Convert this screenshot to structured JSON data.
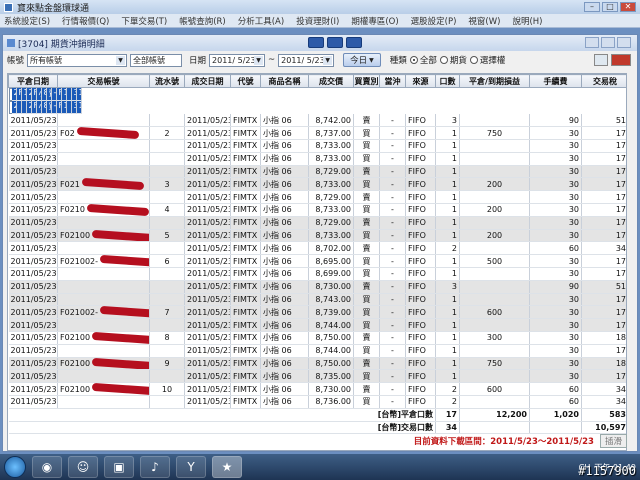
{
  "window": {
    "title": "寶來點金盤環球通"
  },
  "menu": [
    "系統設定(S)",
    "行情報價(Q)",
    "下單交易(T)",
    "帳號查詢(R)",
    "分析工具(A)",
    "投資理財(I)",
    "期權專區(O)",
    "選股設定(P)",
    "視窗(W)",
    "說明(H)"
  ],
  "child": {
    "title": "[3704] 期貨沖銷明細",
    "mid_icons": [
      "grid-icon",
      "chart-icon",
      "close-panel-icon"
    ]
  },
  "toolbar": {
    "account_label": "帳號",
    "account_value": "所有帳號",
    "all_accounts": "全部帳號",
    "date_label": "日期",
    "date_from": "2011/ 5/23",
    "tilde": "~",
    "date_to": "2011/ 5/23",
    "today_button": "今日",
    "type_label": "種類",
    "opt_all": "全部",
    "opt_future": "期貨",
    "opt_option": "選擇權"
  },
  "columns": [
    "平倉日期",
    "交易帳號",
    "流水號",
    "成交日期",
    "代號",
    "商品名稱",
    "成交價",
    "買賣別",
    "當沖",
    "來源",
    "口數",
    "平倉/到期損益",
    "手續費",
    "交易稅"
  ],
  "rows": [
    {
      "group": 1,
      "sel": true,
      "date": "2011/05/23",
      "acct": "F0",
      "serial": "1",
      "tdate": "2011/05/20",
      "code": "FIMTX",
      "name": "小指 06",
      "price": "8,809.00",
      "bs": "賣",
      "dt": "-",
      "src": "FIFO",
      "qty": "1",
      "pnl": "",
      "fee": "30",
      "tax": "18"
    },
    {
      "group": 1,
      "sel": true,
      "date": "2011/05/23",
      "acct": "",
      "serial": "",
      "tdate": "2011/05/20",
      "code": "FIMTX",
      "name": "小指 06",
      "price": "8,821.00",
      "bs": "買",
      "dt": "-",
      "src": "FIFO",
      "qty": "1",
      "pnl": "",
      "fee": "30",
      "tax": "18"
    },
    {
      "group": 2,
      "date": "2011/05/23",
      "acct": "",
      "serial": "",
      "tdate": "2011/05/23",
      "code": "FIMTX",
      "name": "小指 06",
      "price": "8,742.00",
      "bs": "賣",
      "dt": "-",
      "src": "FIFO",
      "qty": "3",
      "pnl": "",
      "fee": "90",
      "tax": "51"
    },
    {
      "group": 2,
      "date": "2011/05/23",
      "acct": "F02",
      "serial": "2",
      "tdate": "2011/05/23",
      "code": "FIMTX",
      "name": "小指 06",
      "price": "8,737.00",
      "bs": "買",
      "dt": "-",
      "src": "FIFO",
      "qty": "1",
      "pnl": "750",
      "fee": "30",
      "tax": "17"
    },
    {
      "group": 2,
      "date": "2011/05/23",
      "acct": "",
      "serial": "",
      "tdate": "2011/05/23",
      "code": "FIMTX",
      "name": "小指 06",
      "price": "8,733.00",
      "bs": "買",
      "dt": "-",
      "src": "FIFO",
      "qty": "1",
      "pnl": "",
      "fee": "30",
      "tax": "17"
    },
    {
      "group": 2,
      "date": "2011/05/23",
      "acct": "",
      "serial": "",
      "tdate": "2011/05/23",
      "code": "FIMTX",
      "name": "小指 06",
      "price": "8,733.00",
      "bs": "買",
      "dt": "-",
      "src": "FIFO",
      "qty": "1",
      "pnl": "",
      "fee": "30",
      "tax": "17"
    },
    {
      "group": 3,
      "date": "2011/05/23",
      "acct": "",
      "serial": "",
      "tdate": "2011/05/23",
      "code": "FIMTX",
      "name": "小指 06",
      "price": "8,729.00",
      "bs": "賣",
      "dt": "-",
      "src": "FIFO",
      "qty": "1",
      "pnl": "",
      "fee": "30",
      "tax": "17"
    },
    {
      "group": 3,
      "date": "2011/05/23",
      "acct": "F021",
      "serial": "3",
      "tdate": "2011/05/23",
      "code": "FIMTX",
      "name": "小指 06",
      "price": "8,733.00",
      "bs": "買",
      "dt": "-",
      "src": "FIFO",
      "qty": "1",
      "pnl": "200",
      "fee": "30",
      "tax": "17"
    },
    {
      "group": 4,
      "date": "2011/05/23",
      "acct": "",
      "serial": "",
      "tdate": "2011/05/23",
      "code": "FIMTX",
      "name": "小指 06",
      "price": "8,729.00",
      "bs": "賣",
      "dt": "-",
      "src": "FIFO",
      "qty": "1",
      "pnl": "",
      "fee": "30",
      "tax": "17"
    },
    {
      "group": 4,
      "date": "2011/05/23",
      "acct": "F0210",
      "serial": "4",
      "tdate": "2011/05/23",
      "code": "FIMTX",
      "name": "小指 06",
      "price": "8,733.00",
      "bs": "買",
      "dt": "-",
      "src": "FIFO",
      "qty": "1",
      "pnl": "200",
      "fee": "30",
      "tax": "17"
    },
    {
      "group": 5,
      "date": "2011/05/23",
      "acct": "",
      "serial": "",
      "tdate": "2011/05/23",
      "code": "FIMTX",
      "name": "小指 06",
      "price": "8,729.00",
      "bs": "賣",
      "dt": "-",
      "src": "FIFO",
      "qty": "1",
      "pnl": "",
      "fee": "30",
      "tax": "17"
    },
    {
      "group": 5,
      "date": "2011/05/23",
      "acct": "F02100",
      "serial": "5",
      "tdate": "2011/05/23",
      "code": "FIMTX",
      "name": "小指 06",
      "price": "8,733.00",
      "bs": "買",
      "dt": "-",
      "src": "FIFO",
      "qty": "1",
      "pnl": "200",
      "fee": "30",
      "tax": "17"
    },
    {
      "group": 6,
      "date": "2011/05/23",
      "acct": "",
      "serial": "",
      "tdate": "2011/05/23",
      "code": "FIMTX",
      "name": "小指 06",
      "price": "8,702.00",
      "bs": "賣",
      "dt": "-",
      "src": "FIFO",
      "qty": "2",
      "pnl": "",
      "fee": "60",
      "tax": "34"
    },
    {
      "group": 6,
      "date": "2011/05/23",
      "acct": "F021002-",
      "serial": "6",
      "tdate": "2011/05/23",
      "code": "FIMTX",
      "name": "小指 06",
      "price": "8,695.00",
      "bs": "買",
      "dt": "-",
      "src": "FIFO",
      "qty": "1",
      "pnl": "500",
      "fee": "30",
      "tax": "17"
    },
    {
      "group": 6,
      "date": "2011/05/23",
      "acct": "",
      "serial": "",
      "tdate": "2011/05/23",
      "code": "FIMTX",
      "name": "小指 06",
      "price": "8,699.00",
      "bs": "買",
      "dt": "-",
      "src": "FIFO",
      "qty": "1",
      "pnl": "",
      "fee": "30",
      "tax": "17"
    },
    {
      "group": 7,
      "date": "2011/05/23",
      "acct": "",
      "serial": "",
      "tdate": "2011/05/23",
      "code": "FIMTX",
      "name": "小指 06",
      "price": "8,730.00",
      "bs": "賣",
      "dt": "-",
      "src": "FIFO",
      "qty": "3",
      "pnl": "",
      "fee": "90",
      "tax": "51"
    },
    {
      "group": 7,
      "date": "2011/05/23",
      "acct": "",
      "serial": "",
      "tdate": "2011/05/23",
      "code": "FIMTX",
      "name": "小指 06",
      "price": "8,743.00",
      "bs": "買",
      "dt": "-",
      "src": "FIFO",
      "qty": "1",
      "pnl": "",
      "fee": "30",
      "tax": "17"
    },
    {
      "group": 7,
      "date": "2011/05/23",
      "acct": "F021002-",
      "serial": "7",
      "tdate": "2011/05/23",
      "code": "FIMTX",
      "name": "小指 06",
      "price": "8,739.00",
      "bs": "買",
      "dt": "-",
      "src": "FIFO",
      "qty": "1",
      "pnl": "600",
      "fee": "30",
      "tax": "17"
    },
    {
      "group": 7,
      "date": "2011/05/23",
      "acct": "",
      "serial": "",
      "tdate": "2011/05/23",
      "code": "FIMTX",
      "name": "小指 06",
      "price": "8,744.00",
      "bs": "買",
      "dt": "-",
      "src": "FIFO",
      "qty": "1",
      "pnl": "",
      "fee": "30",
      "tax": "17"
    },
    {
      "group": 8,
      "date": "2011/05/23",
      "acct": "F02100",
      "serial": "8",
      "tdate": "2011/05/23",
      "code": "FIMTX",
      "name": "小指 06",
      "price": "8,750.00",
      "bs": "賣",
      "dt": "-",
      "src": "FIFO",
      "qty": "1",
      "pnl": "300",
      "fee": "30",
      "tax": "18"
    },
    {
      "group": 8,
      "date": "2011/05/23",
      "acct": "",
      "serial": "",
      "tdate": "2011/05/23",
      "code": "FIMTX",
      "name": "小指 06",
      "price": "8,744.00",
      "bs": "買",
      "dt": "-",
      "src": "FIFO",
      "qty": "1",
      "pnl": "",
      "fee": "30",
      "tax": "17"
    },
    {
      "group": 9,
      "date": "2011/05/23",
      "acct": "F02100",
      "serial": "9",
      "tdate": "2011/05/23",
      "code": "FIMTX",
      "name": "小指 06",
      "price": "8,750.00",
      "bs": "賣",
      "dt": "-",
      "src": "FIFO",
      "qty": "1",
      "pnl": "750",
      "fee": "30",
      "tax": "18"
    },
    {
      "group": 9,
      "date": "2011/05/23",
      "acct": "",
      "serial": "",
      "tdate": "2011/05/23",
      "code": "FIMTX",
      "name": "小指 06",
      "price": "8,735.00",
      "bs": "買",
      "dt": "-",
      "src": "FIFO",
      "qty": "1",
      "pnl": "",
      "fee": "30",
      "tax": "17"
    },
    {
      "group": 10,
      "date": "2011/05/23",
      "acct": "F02100",
      "serial": "10",
      "tdate": "2011/05/23",
      "code": "FIMTX",
      "name": "小指 06",
      "price": "8,730.00",
      "bs": "賣",
      "dt": "-",
      "src": "FIFO",
      "qty": "2",
      "pnl": "600",
      "fee": "60",
      "tax": "34"
    },
    {
      "group": 10,
      "date": "2011/05/23",
      "acct": "",
      "serial": "",
      "tdate": "2011/05/23",
      "code": "FIMTX",
      "name": "小指 06",
      "price": "8,736.00",
      "bs": "買",
      "dt": "-",
      "src": "FIFO",
      "qty": "2",
      "pnl": "",
      "fee": "60",
      "tax": "34"
    }
  ],
  "summary": {
    "close_label": "[台幣]平倉口數",
    "close_qty": "17",
    "close_pnl": "12,200",
    "close_fee": "1,020",
    "close_tax": "583",
    "trade_label": "[台幣]交易口數",
    "trade_qty": "34",
    "trade_tax": "10,597"
  },
  "footer": {
    "range": "目前資料下載區間：2011/5/23～2011/5/23",
    "export": "插滑"
  },
  "taskbar": {
    "apps": [
      "firefox-icon",
      "messenger-icon",
      "box-icon",
      "speaker-icon",
      "yahoo-icon",
      "game-icon"
    ],
    "lang": "CH",
    "clock": "下午 01:49"
  },
  "watermark": "#1157900",
  "colors": {
    "selected_row": "#1b5ab8",
    "buy": "#0a8a0a",
    "sell_pnl": "#cc1111"
  }
}
